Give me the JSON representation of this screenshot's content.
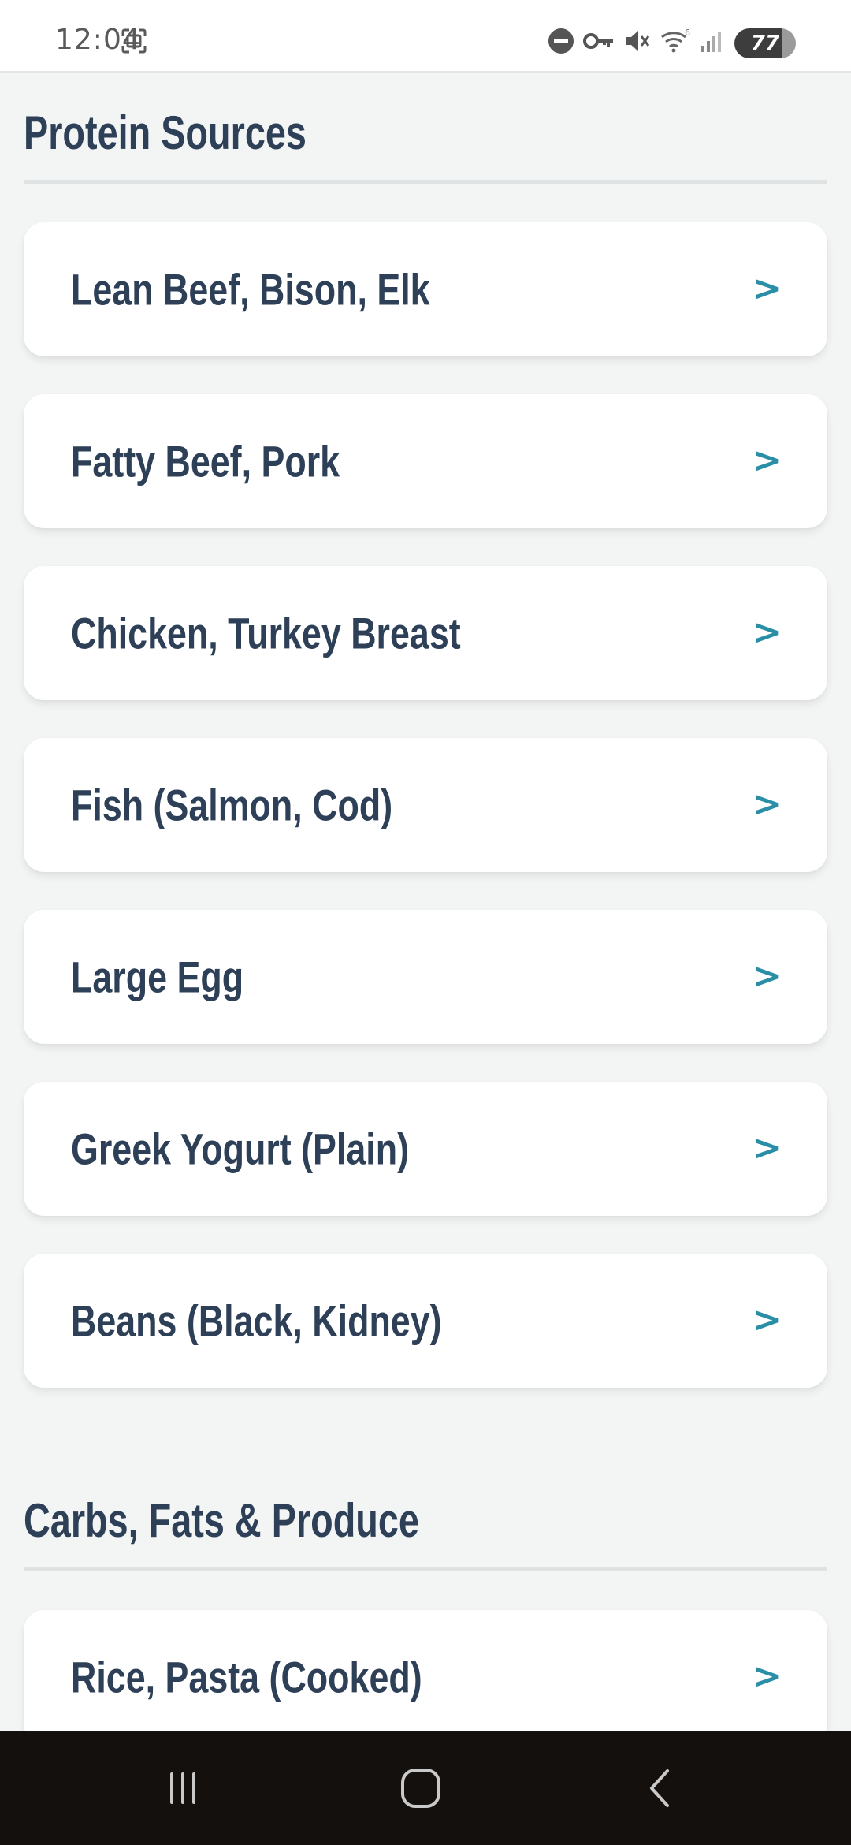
{
  "status_bar": {
    "time": "12:04",
    "battery": "77",
    "icons": [
      "screenshot-icon",
      "do-not-disturb-icon",
      "vpn-key-icon",
      "mute-icon",
      "wifi-icon",
      "signal-icon",
      "battery-icon"
    ]
  },
  "sections": [
    {
      "title": "Protein Sources",
      "items": [
        {
          "label": "Lean Beef, Bison, Elk",
          "chevron": ">"
        },
        {
          "label": "Fatty Beef, Pork",
          "chevron": ">"
        },
        {
          "label": "Chicken, Turkey Breast",
          "chevron": ">"
        },
        {
          "label": "Fish (Salmon, Cod)",
          "chevron": ">"
        },
        {
          "label": "Large Egg",
          "chevron": ">"
        },
        {
          "label": "Greek Yogurt (Plain)",
          "chevron": ">"
        },
        {
          "label": "Beans (Black, Kidney)",
          "chevron": ">"
        }
      ]
    },
    {
      "title": "Carbs, Fats & Produce",
      "items": [
        {
          "label": "Rice, Pasta (Cooked)",
          "chevron": ">"
        }
      ]
    }
  ],
  "nav_bar": {
    "icons": [
      "recent-apps-icon",
      "home-icon",
      "back-icon"
    ]
  },
  "colors": {
    "heading": "#2e4057",
    "accent": "#2a8fa6",
    "background": "#f3f5f5",
    "card": "#ffffff"
  }
}
